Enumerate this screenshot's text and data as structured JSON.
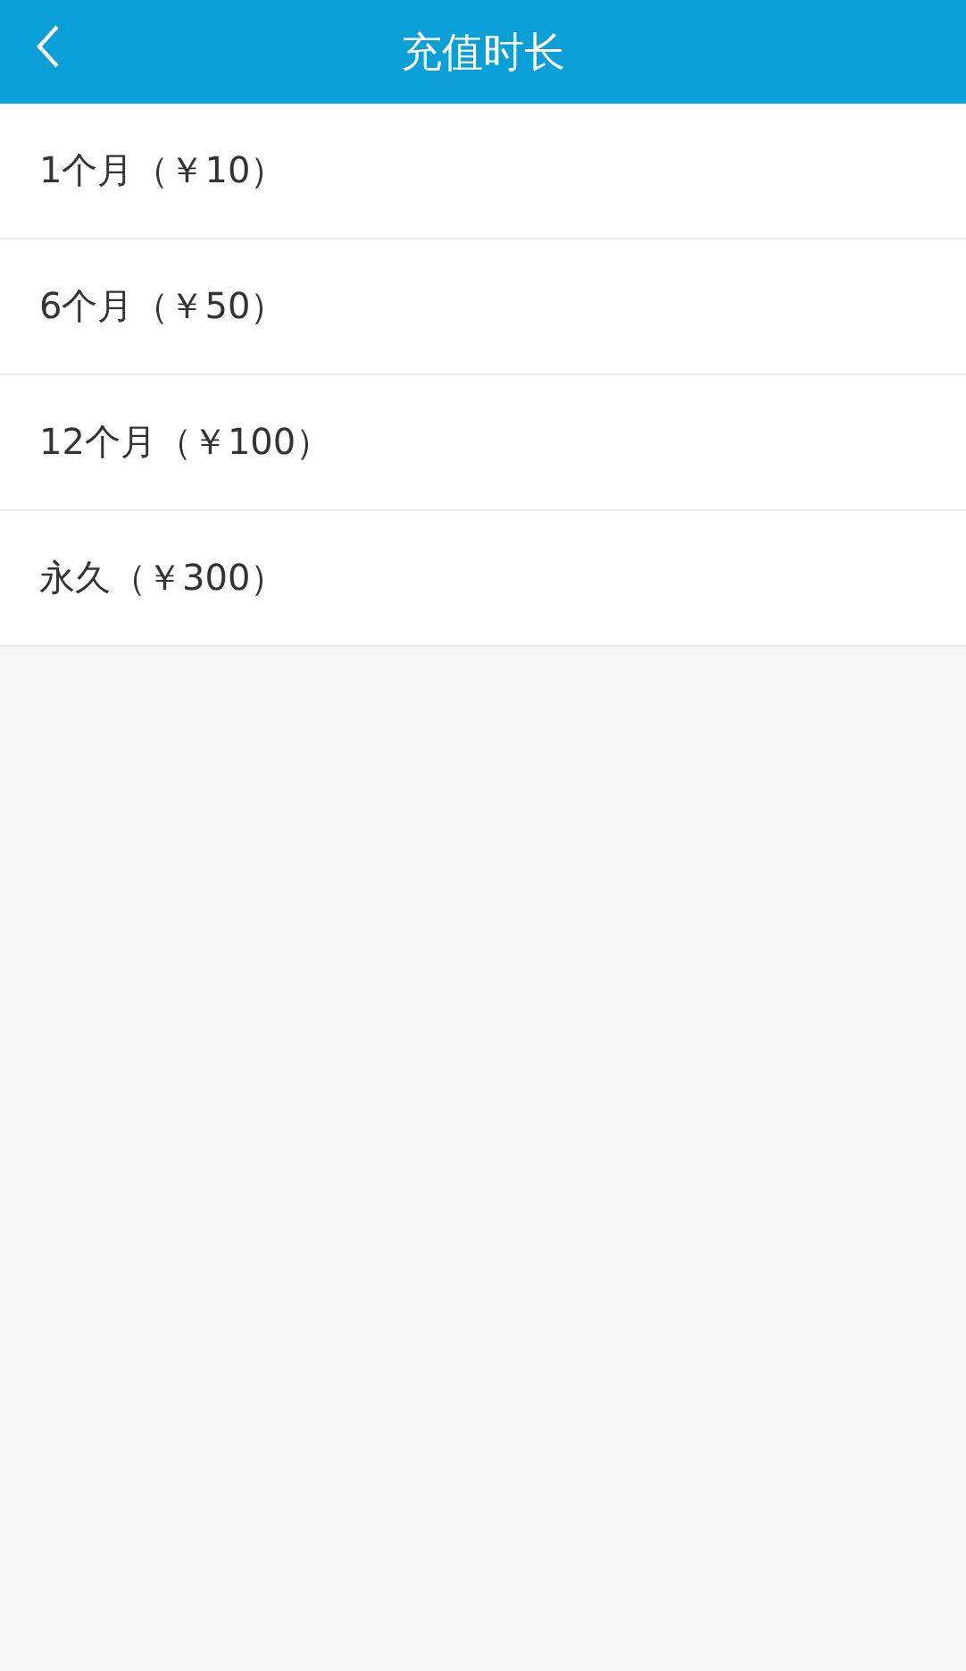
{
  "header": {
    "title": "充值时长"
  },
  "options": [
    {
      "label": "1个月（￥10）"
    },
    {
      "label": "6个月（￥50）"
    },
    {
      "label": "12个月（￥100）"
    },
    {
      "label": "永久（￥300）"
    }
  ]
}
